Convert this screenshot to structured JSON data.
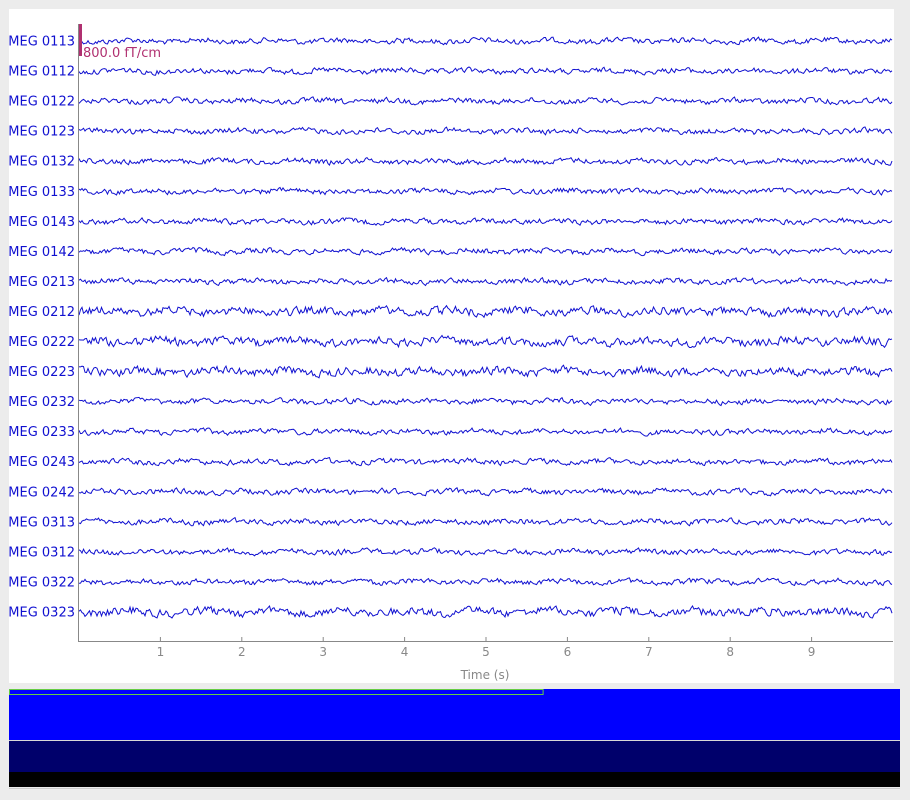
{
  "channels": [
    "MEG 0113",
    "MEG 0112",
    "MEG 0122",
    "MEG 0123",
    "MEG 0132",
    "MEG 0133",
    "MEG 0143",
    "MEG 0142",
    "MEG 0213",
    "MEG 0212",
    "MEG 0222",
    "MEG 0223",
    "MEG 0232",
    "MEG 0233",
    "MEG 0243",
    "MEG 0242",
    "MEG 0313",
    "MEG 0312",
    "MEG 0322",
    "MEG 0323"
  ],
  "scale_bar": {
    "label": "800.0 fT/cm"
  },
  "time_axis": {
    "label": "Time (s)",
    "ticks": [
      "1",
      "2",
      "3",
      "4",
      "5",
      "6",
      "7",
      "8",
      "9"
    ],
    "range": [
      0,
      10
    ]
  },
  "overview": {
    "visible_window_fraction": 0.6
  },
  "colors": {
    "trace": "#1010d0",
    "scale_bar": "#b03070",
    "overview_blue": "#0000ff",
    "overview_dark": "#00006b",
    "window_outline": "#66cc44"
  }
}
